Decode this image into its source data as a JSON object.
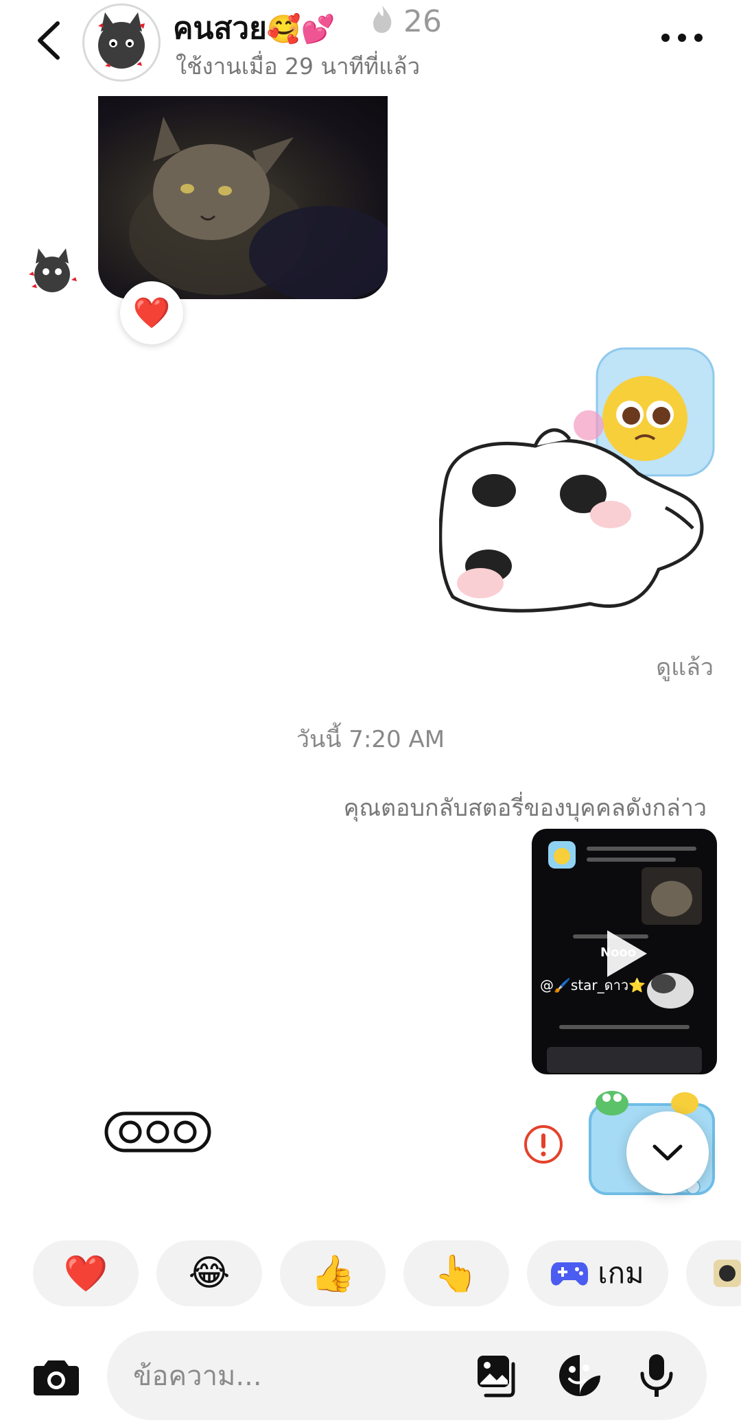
{
  "header": {
    "title": "คนสวย",
    "title_emojis": "🥰💕",
    "streak_icon": "flame-icon",
    "streak_count": "26",
    "status": "ใช้งานเมื่อ 29 นาทีที่แล้ว"
  },
  "messages": {
    "reaction_emoji": "❤️",
    "seen_label": "ดูแล้ว",
    "date_divider": "วันนี้ 7:20 AM",
    "story_reply_label": "คุณตอบกลับสตอรี่ของบุคคลดังกล่าว",
    "story_card": {
      "mention": "@🖌️star_ดาว⭐",
      "overlay_text": "Nooo"
    }
  },
  "quick_reactions": [
    {
      "emoji": "❤️"
    },
    {
      "emoji": "😂"
    },
    {
      "emoji": "👍"
    },
    {
      "emoji": "👆"
    }
  ],
  "quick_game": {
    "icon": "gamepad-icon",
    "label": "เกม"
  },
  "composer": {
    "placeholder": "ข้อความ..."
  },
  "colors": {
    "error": "#e4412b",
    "heart": "#e4162b",
    "chip_bg": "#f2f2f2",
    "game_icon": "#4b5cf0"
  }
}
